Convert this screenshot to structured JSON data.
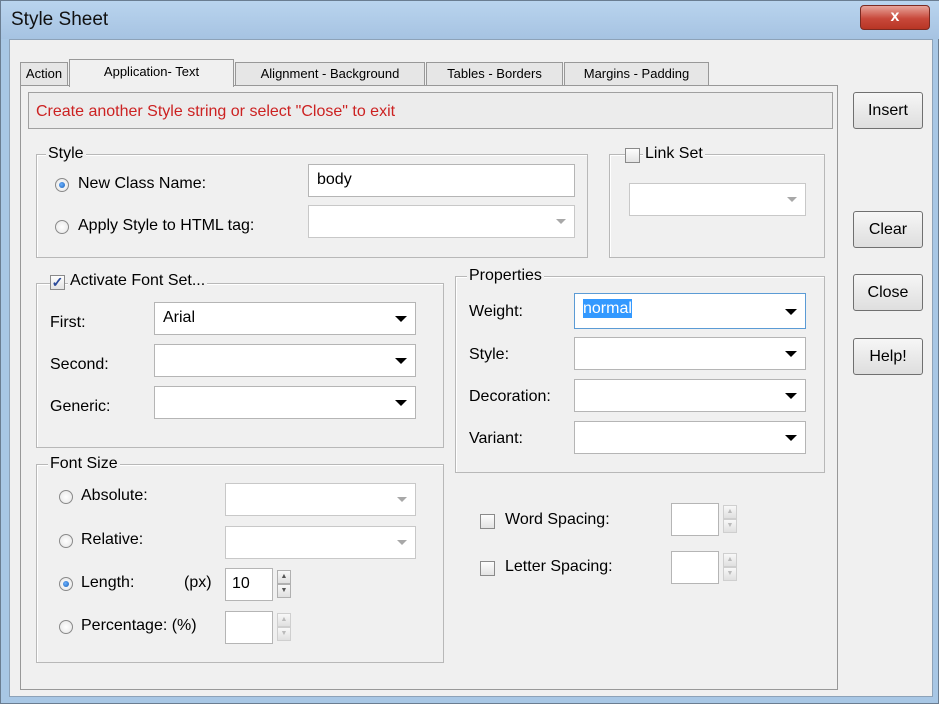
{
  "window": {
    "title": "Style Sheet",
    "close_glyph": "x"
  },
  "tabs": [
    {
      "label": "Action"
    },
    {
      "label": "Application- Text"
    },
    {
      "label": "Alignment - Background"
    },
    {
      "label": "Tables - Borders"
    },
    {
      "label": "Margins - Padding"
    }
  ],
  "message": "Create another Style string or select \"Close\" to exit",
  "style_group": {
    "legend": "Style",
    "new_class_label": "New Class Name:",
    "new_class_value": "body",
    "apply_tag_label": "Apply Style to HTML tag:",
    "apply_tag_value": ""
  },
  "link_set": {
    "label": "Link Set",
    "value": ""
  },
  "font_set": {
    "label": "Activate Font Set...",
    "first_label": "First:",
    "first_value": "Arial",
    "second_label": "Second:",
    "second_value": "",
    "generic_label": "Generic:",
    "generic_value": ""
  },
  "properties": {
    "legend": "Properties",
    "weight_label": "Weight:",
    "weight_value": "normal",
    "style_label": "Style:",
    "style_value": "",
    "decoration_label": "Decoration:",
    "decoration_value": "",
    "variant_label": "Variant:",
    "variant_value": ""
  },
  "font_size": {
    "legend": "Font Size",
    "absolute_label": "Absolute:",
    "relative_label": "Relative:",
    "length_label": "Length:",
    "length_unit": "(px)",
    "length_value": "10",
    "percentage_label": "Percentage: (%)",
    "percentage_value": ""
  },
  "spacing": {
    "word_label": "Word Spacing:",
    "word_value": "",
    "letter_label": "Letter Spacing:",
    "letter_value": ""
  },
  "buttons": {
    "insert": "Insert",
    "clear": "Clear",
    "close": "Close",
    "help": "Help!"
  },
  "colors": {
    "message": "#cc2222",
    "selection": "#3399ff",
    "title_bar": "#a8c7e5"
  }
}
